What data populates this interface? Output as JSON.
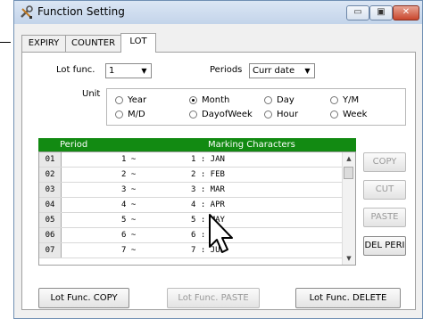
{
  "window": {
    "title": "Function Setting",
    "min_glyph": "▭",
    "max_glyph": "▣",
    "close_glyph": "✕"
  },
  "tabs": [
    {
      "label": "EXPIRY",
      "active": false
    },
    {
      "label": "COUNTER",
      "active": false
    },
    {
      "label": "LOT",
      "active": true
    }
  ],
  "lot": {
    "lot_func_label": "Lot func.",
    "lot_func_value": "1",
    "periods_label": "Periods",
    "periods_value": "Curr date",
    "unit_label": "Unit",
    "units": [
      {
        "label": "Year",
        "selected": false
      },
      {
        "label": "Month",
        "selected": true
      },
      {
        "label": "Day",
        "selected": false
      },
      {
        "label": "Y/M",
        "selected": false
      },
      {
        "label": "M/D",
        "selected": false
      },
      {
        "label": "DayofWeek",
        "selected": false
      },
      {
        "label": "Hour",
        "selected": false
      },
      {
        "label": "Week",
        "selected": false
      }
    ]
  },
  "table": {
    "headers": [
      "Period",
      "Marking Characters"
    ],
    "rows": [
      {
        "num": "01",
        "period": "1 ~",
        "mark": "1 : JAN"
      },
      {
        "num": "02",
        "period": "2 ~",
        "mark": "2 : FEB"
      },
      {
        "num": "03",
        "period": "3 ~",
        "mark": "3 : MAR"
      },
      {
        "num": "04",
        "period": "4 ~",
        "mark": "4 : APR"
      },
      {
        "num": "05",
        "period": "5 ~",
        "mark": "5 : MAY"
      },
      {
        "num": "06",
        "period": "6 ~",
        "mark": "6 : JUN"
      },
      {
        "num": "07",
        "period": "7 ~",
        "mark": "7 : JUL"
      }
    ]
  },
  "side_buttons": [
    {
      "label": "COPY",
      "enabled": false
    },
    {
      "label": "CUT",
      "enabled": false
    },
    {
      "label": "PASTE",
      "enabled": false
    },
    {
      "label": "DEL PERI",
      "enabled": true
    }
  ],
  "bottom_buttons": [
    {
      "label": "Lot Func. COPY",
      "enabled": true
    },
    {
      "label": "Lot Func. PASTE",
      "enabled": false
    },
    {
      "label": "Lot Func. DELETE",
      "enabled": true
    }
  ],
  "icons": {
    "app": "wrench-screwdriver-icon",
    "dropdown": "▼",
    "scroll_up": "▲",
    "scroll_down": "▼"
  },
  "colors": {
    "grid_header": "#128a12",
    "title_bar": "#c3d4ea"
  }
}
